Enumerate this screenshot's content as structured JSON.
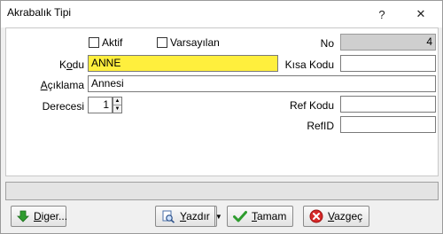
{
  "window": {
    "title": "Akrabalık Tipi",
    "help_glyph": "?",
    "close_glyph": "✕"
  },
  "form": {
    "aktif_label": "Aktif",
    "aktif_checked": false,
    "varsayilan_label": "Varsayılan",
    "varsayilan_checked": false,
    "no_label": "No",
    "no_value": "4",
    "kodu_label_pre": "K",
    "kodu_label_u": "o",
    "kodu_label_post": "du",
    "kodu_value": "ANNE",
    "kisa_kodu_label": "Kısa Kodu",
    "kisa_kodu_value": "",
    "aciklama_label_u": "A",
    "aciklama_label_post": "çıklama",
    "aciklama_value": "Annesi",
    "derecesi_label": "Derecesi",
    "derecesi_value": "1",
    "ref_kodu_label": "Ref Kodu",
    "ref_kodu_value": "",
    "refid_label": "RefID",
    "refid_value": ""
  },
  "status": {
    "text": ""
  },
  "buttons": {
    "diger_u": "D",
    "diger_post": "iger...",
    "yazdir_u": "Y",
    "yazdir_post": "azdır",
    "tamam_u": "T",
    "tamam_post": "amam",
    "vazgec_u": "V",
    "vazgec_post": "azgeç"
  },
  "colors": {
    "kodu_highlight": "#ffef3d",
    "no_readonly": "#cfcfcf",
    "ok_icon": "#2e9c2e",
    "cancel_icon": "#d62a2a",
    "diger_icon": "#2e9c2e"
  }
}
